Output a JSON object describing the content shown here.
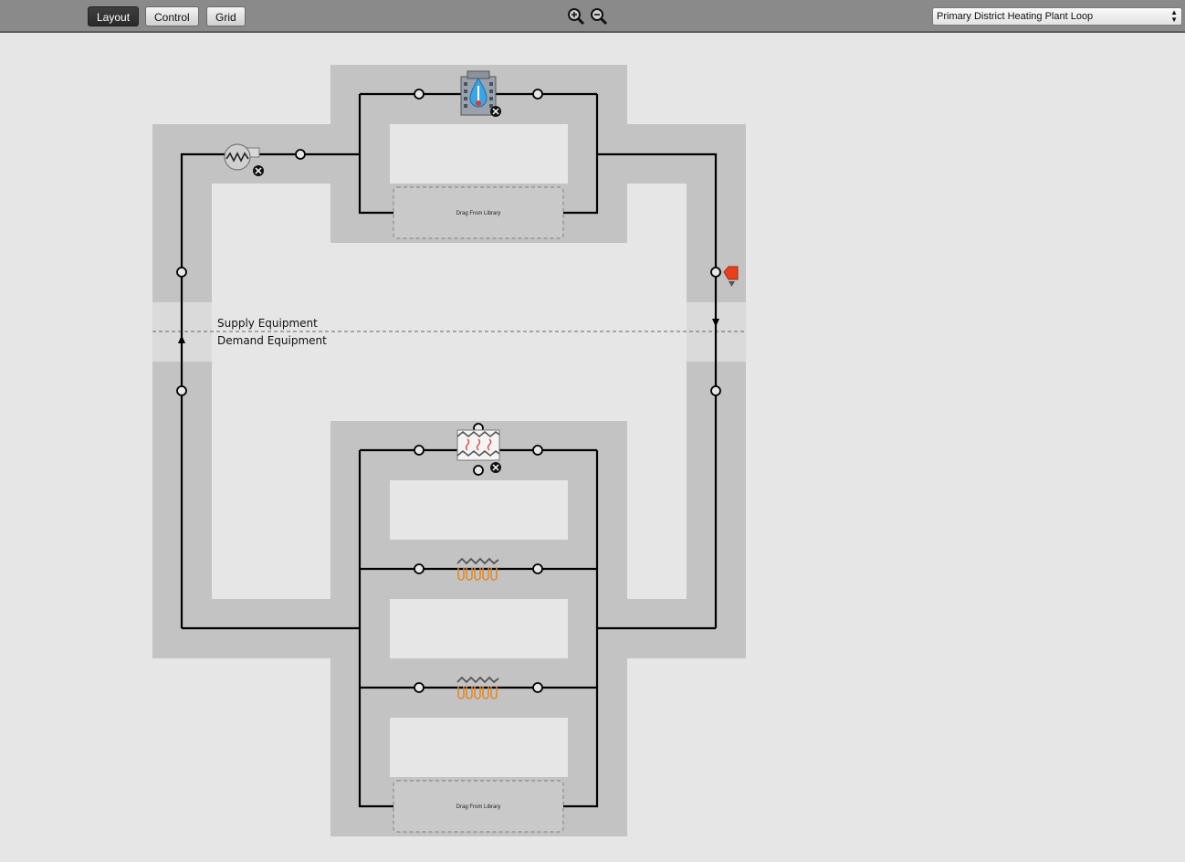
{
  "toolbar": {
    "layout_label": "Layout",
    "control_label": "Control",
    "grid_label": "Grid",
    "zoom_in_icon": "zoom-in-icon",
    "zoom_out_icon": "zoom-out-icon",
    "loop_selector_value": "Primary District Heating Plant Loop"
  },
  "diagram": {
    "supply_label": "Supply Equipment",
    "demand_label": "Demand Equipment",
    "supply_drop_zone_label": "Drag From Library",
    "demand_drop_zone_label": "Drag From Library",
    "components": {
      "pump_icon": "pump-icon",
      "district_heating_icon": "district-heating-icon",
      "setpoint_manager_icon": "setpoint-manager-icon",
      "water_heater_icon": "water-heater-icon",
      "heating_coil_1_icon": "heating-coil-icon",
      "heating_coil_2_icon": "heating-coil-icon",
      "remove_icon": "remove-icon"
    }
  },
  "colors": {
    "loop_band": "#c3c3c3",
    "background": "#e6e6e6",
    "pipe": "#000000",
    "toolbar": "#8a8a8a",
    "setpoint": "#e8401c"
  }
}
